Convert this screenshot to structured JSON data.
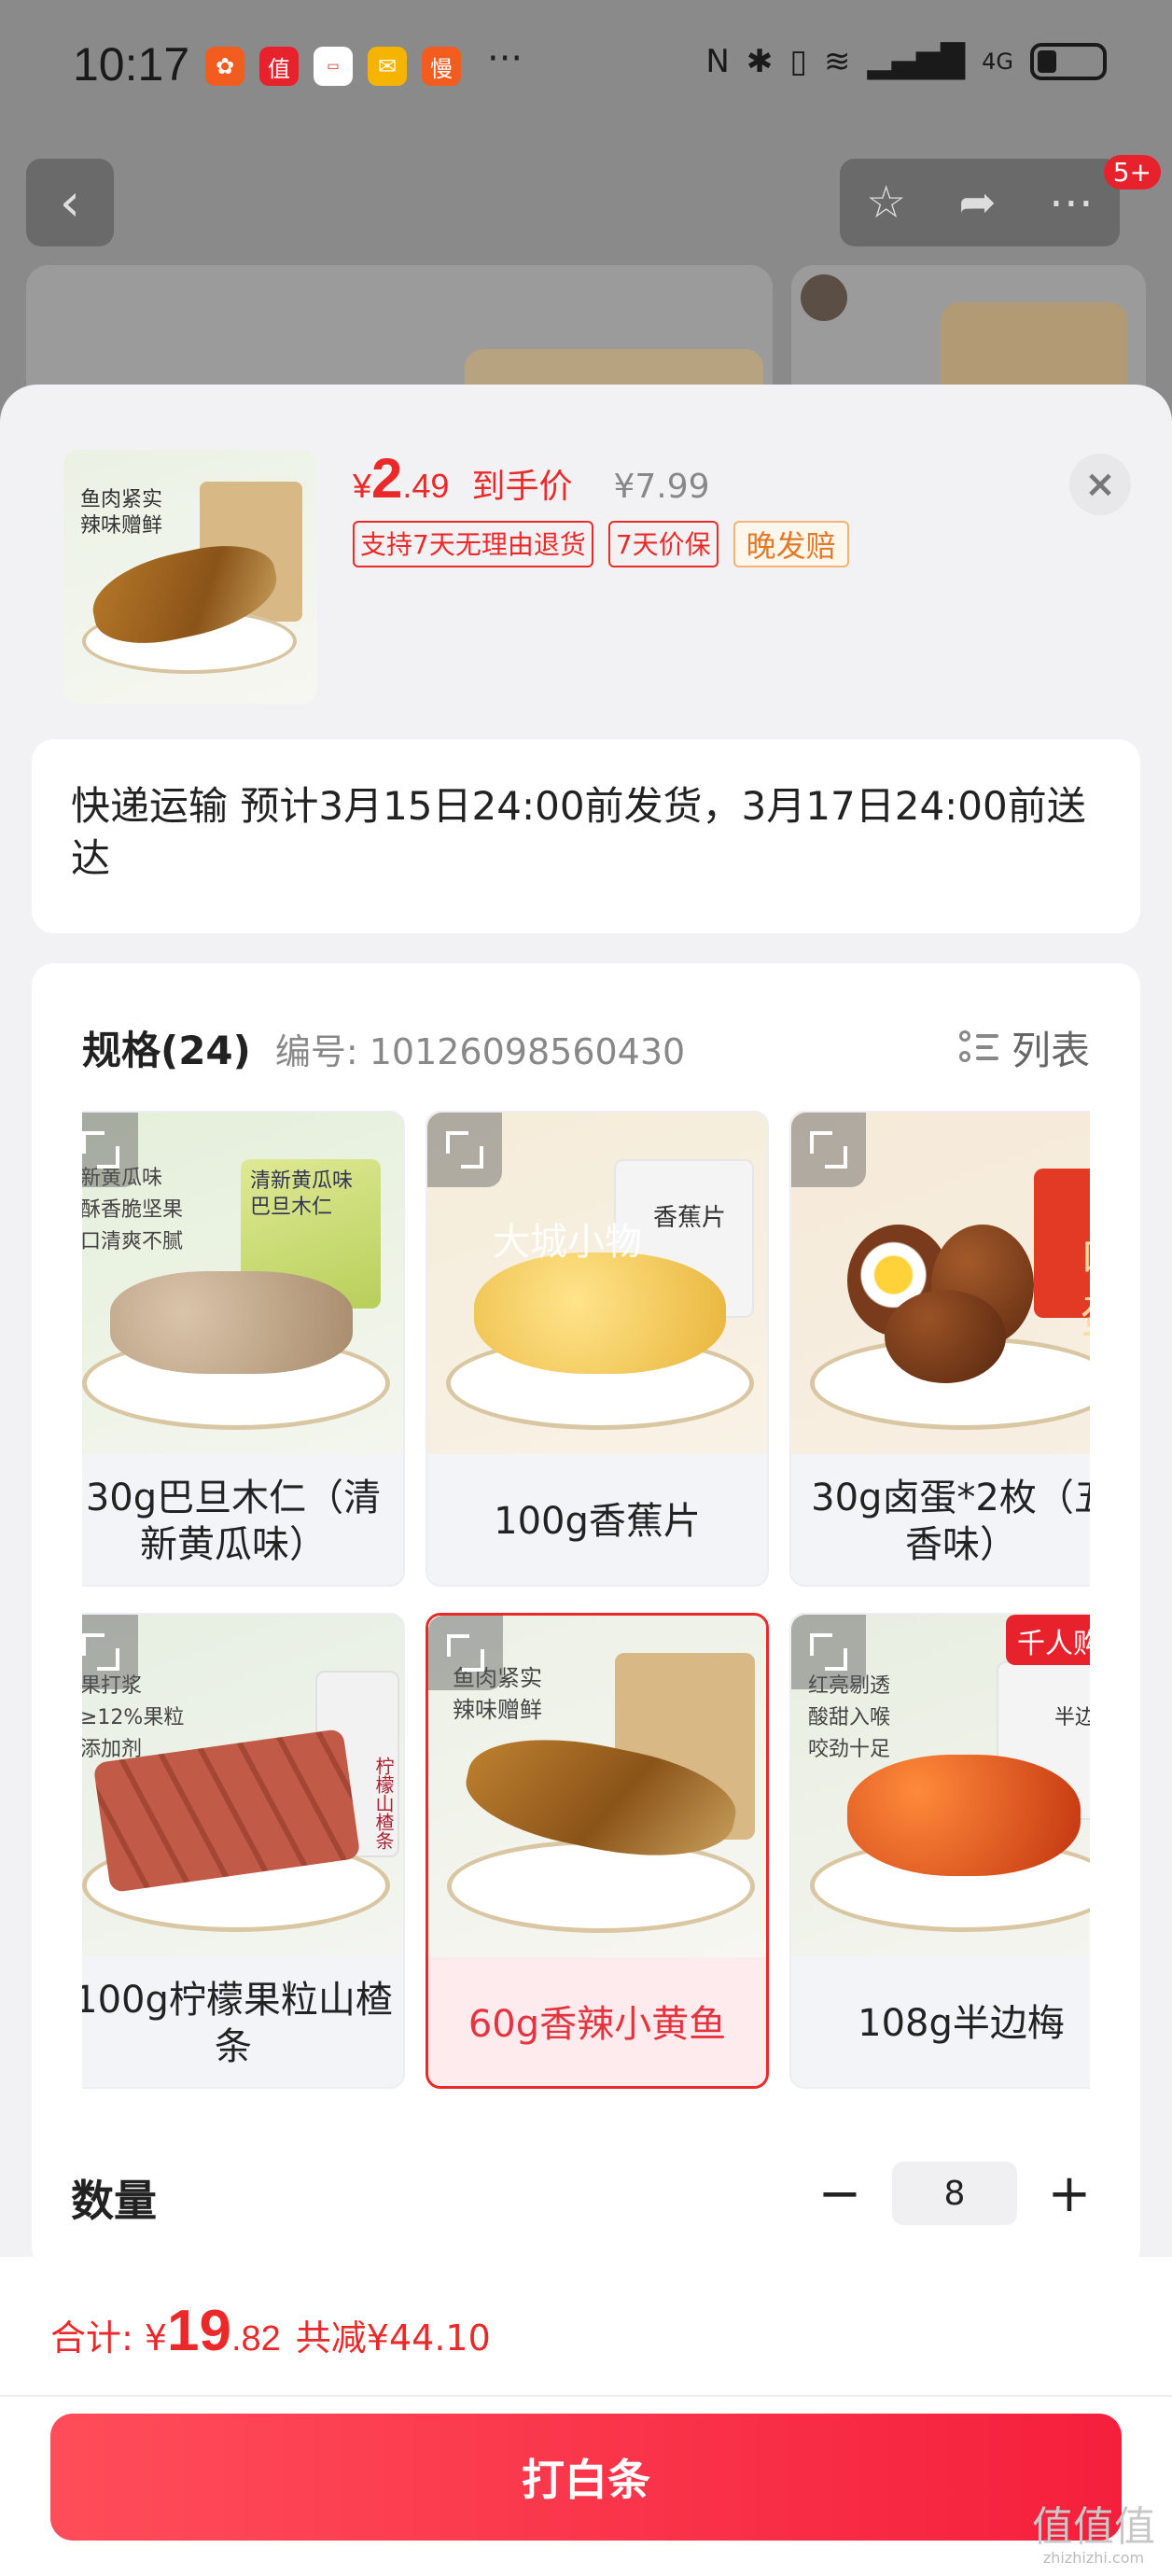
{
  "status_bar": {
    "time": "10:17",
    "more": "···",
    "network": "4G"
  },
  "background": {
    "badge": "5+"
  },
  "product": {
    "thumb_caption_1": "鱼肉紧实",
    "thumb_caption_2": "辣味赠鲜",
    "currency": "¥",
    "price_int": "2",
    "price_dec": ".49",
    "price_label": "到手价",
    "original_price": "¥7.99",
    "tags": [
      "支持7天无理由退货",
      "7天价保",
      "晚发赔"
    ]
  },
  "delivery": {
    "text": "快递运输 预计3月15日24:00前发货，3月17日24:00前送达"
  },
  "spec": {
    "title": "规格(24)",
    "code": "编号: 10126098560430",
    "list_label": "列表",
    "items": [
      {
        "label": "30g巴旦木仁（清新黄瓜味）",
        "caption": [
          "新黄瓜味",
          "酥香脆坚果",
          "口清爽不腻"
        ],
        "bag_text": "清新黄瓜味 巴旦木仁"
      },
      {
        "label": "100g香蕉片",
        "bag_text": "香蕉片",
        "watermark": "大城小物"
      },
      {
        "label": "30g卤蛋*2枚（五香味）",
        "bag_text": "卤蛋"
      },
      {
        "label": "100g柠檬果粒山楂条",
        "caption": [
          "果打浆",
          "≥12%果粒",
          "添加剂"
        ],
        "bag_text": "柠檬山楂条"
      },
      {
        "label": "60g香辣小黄鱼",
        "caption": [
          "鱼肉紧实",
          "辣味赠鲜"
        ],
        "selected": true
      },
      {
        "label": "108g半边梅",
        "caption": [
          "红亮剔透",
          "酸甜入喉",
          "咬劲十足"
        ],
        "bag_text": "半边梅",
        "badge": "千人购买"
      }
    ]
  },
  "quantity": {
    "label": "数量",
    "minus": "−",
    "value": "8",
    "plus": "+"
  },
  "footer": {
    "total_label": "合计:",
    "currency": "¥",
    "total_int": "19",
    "total_dec": ".82",
    "saving": "共减¥44.10",
    "pay_button": "打白条",
    "site_mark": "值值值",
    "site_url": "zhizhizhi.com"
  },
  "colors": {
    "accent": "#ea2a2a",
    "pay_button": "#f51f3c",
    "tag_orange": "#e07a28"
  }
}
